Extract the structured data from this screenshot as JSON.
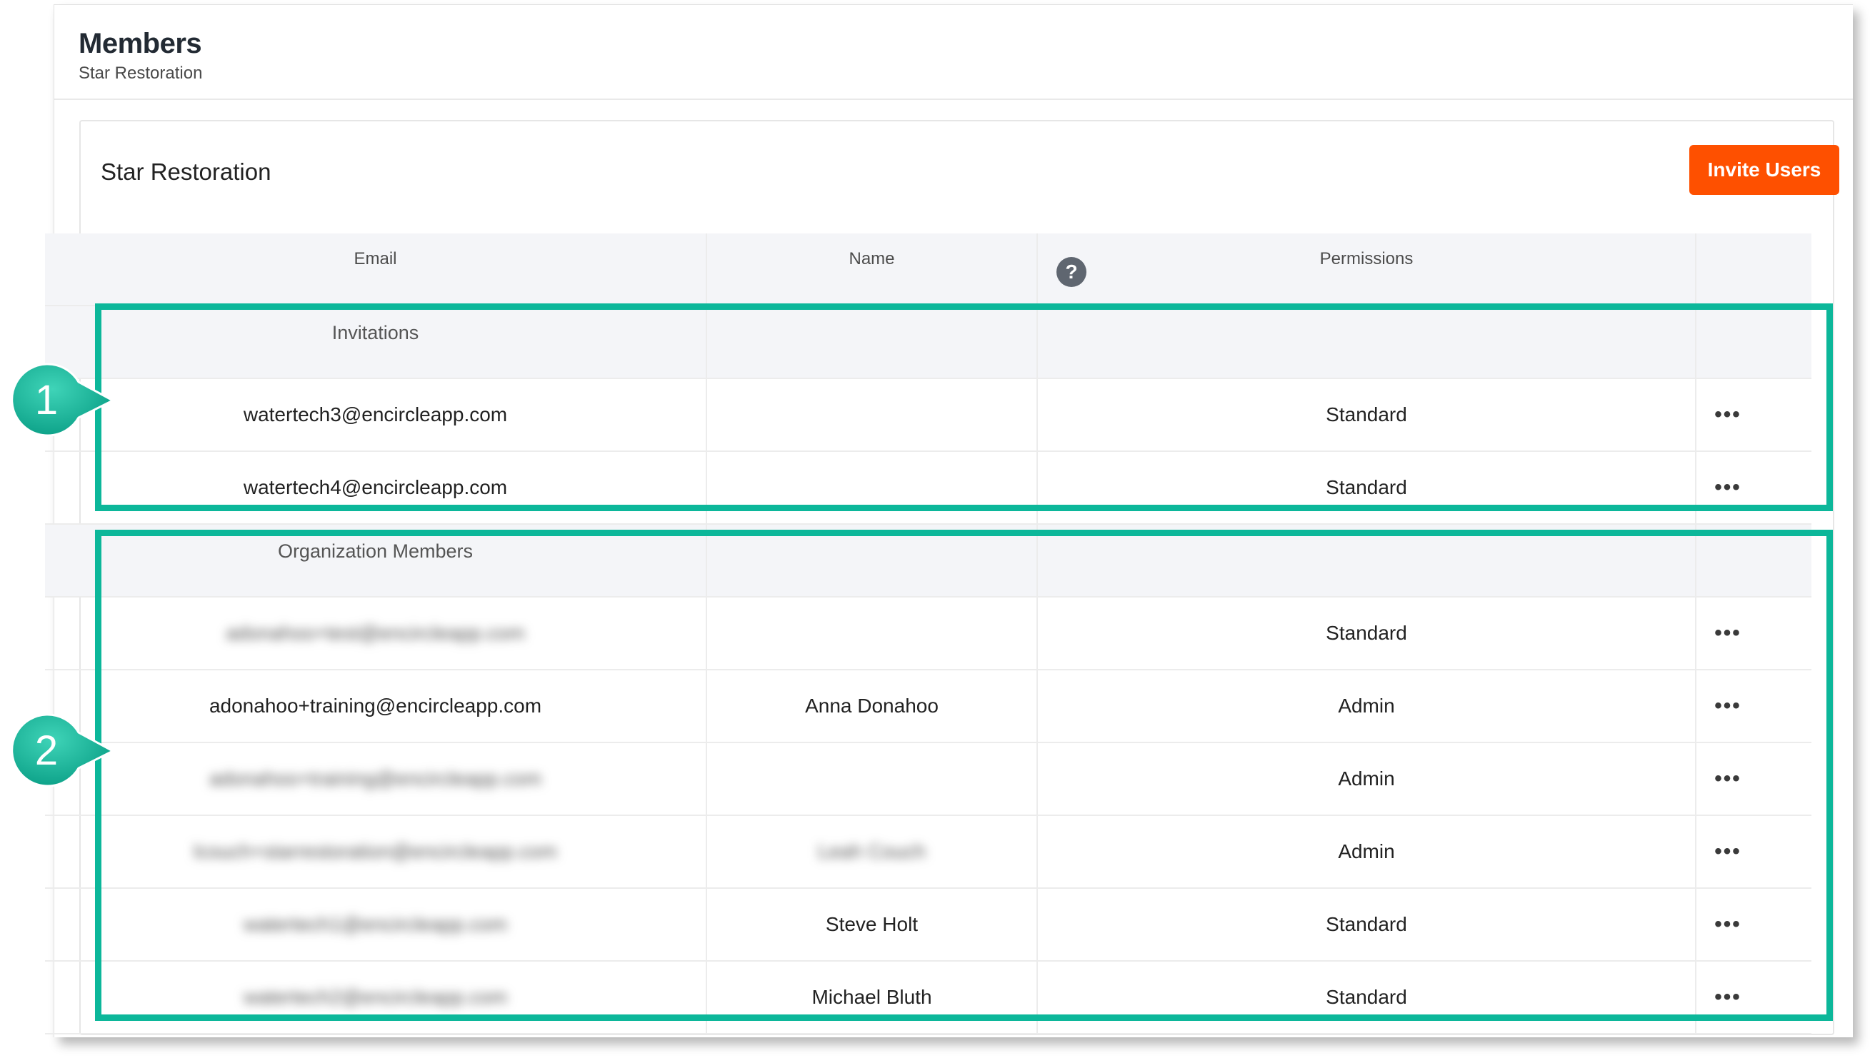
{
  "header": {
    "title": "Members",
    "subtitle": "Star Restoration"
  },
  "card": {
    "title": "Star Restoration",
    "invite_button": "Invite Users"
  },
  "table": {
    "columns": [
      "Email",
      "Name",
      "Permissions",
      ""
    ],
    "help_icon": "help-question-icon",
    "sections": [
      {
        "label": "Invitations",
        "rows": [
          {
            "email": "watertech3@encircleapp.com",
            "name": "",
            "permission": "Standard",
            "blurred_email": false,
            "blurred_name": false
          },
          {
            "email": "watertech4@encircleapp.com",
            "name": "",
            "permission": "Standard",
            "blurred_email": false,
            "blurred_name": false
          }
        ]
      },
      {
        "label": "Organization Members",
        "rows": [
          {
            "email": "adonahoo+test@encircleapp.com",
            "name": "",
            "permission": "Standard",
            "blurred_email": true,
            "blurred_name": false
          },
          {
            "email": "adonahoo+training@encircleapp.com",
            "name": "Anna Donahoo",
            "permission": "Admin",
            "blurred_email": false,
            "blurred_name": false
          },
          {
            "email": "adonahoo+training@encircleapp.com",
            "name": "",
            "permission": "Admin",
            "blurred_email": true,
            "blurred_name": false
          },
          {
            "email": "lcouch+starrestoration@encircleapp.com",
            "name": "Leah Couch",
            "permission": "Admin",
            "blurred_email": true,
            "blurred_name": true
          },
          {
            "email": "watertech1@encircleapp.com",
            "name": "Steve Holt",
            "permission": "Standard",
            "blurred_email": true,
            "blurred_name": false
          },
          {
            "email": "watertech2@encircleapp.com",
            "name": "Michael Bluth",
            "permission": "Standard",
            "blurred_email": true,
            "blurred_name": false
          }
        ]
      }
    ],
    "more_icon_glyph": "•••"
  },
  "annotations": {
    "marker_1": "1",
    "marker_2": "2",
    "highlight_color": "#0cb79a"
  },
  "colors": {
    "accent": "#fe5000",
    "highlight": "#0cb79a"
  }
}
